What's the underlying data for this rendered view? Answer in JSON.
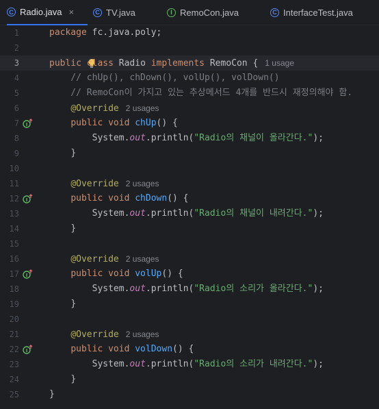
{
  "tabs": [
    {
      "label": "Radio.java",
      "icon": "class-icon",
      "active": true,
      "close": "×"
    },
    {
      "label": "TV.java",
      "icon": "class-icon",
      "active": false
    },
    {
      "label": "RemoCon.java",
      "icon": "interface-icon",
      "active": false
    },
    {
      "label": "InterfaceTest.java",
      "icon": "class-icon",
      "active": false
    }
  ],
  "current_line": 3,
  "line_numbers": [
    "1",
    "2",
    "3",
    "4",
    "5",
    "6",
    "7",
    "8",
    "9",
    "10",
    "11",
    "12",
    "13",
    "14",
    "15",
    "16",
    "17",
    "18",
    "19",
    "20",
    "21",
    "22",
    "23",
    "24",
    "25"
  ],
  "code": {
    "l1_package": "package",
    "l1_name": " fc.java.poly;",
    "l3_public": "public",
    "l3_class": "class",
    "l3_name": " Radio ",
    "l3_implements": "implements",
    "l3_rest": " RemoCon {",
    "l3_hint": "1 usage",
    "l4_comment": "    // chUp(), chDown(), volUp(), volDown()",
    "l5_comment": "    // RemoCon이 가지고 있는 추상메서드 4개를 반드시 재정의해야 함.",
    "override": "@Override",
    "usages": "2 usages",
    "public_void": "public void",
    "system": "System.",
    "out": "out",
    "println": ".println(",
    "close_stmt": ");",
    "close_brace": "}",
    "methods": [
      {
        "name": "chUp",
        "text": "\"Radio의 채널이 올라간다.\""
      },
      {
        "name": "chDown",
        "text": "\"Radio의 채널이 내려간다.\""
      },
      {
        "name": "volUp",
        "text": "\"Radio의 소리가 올라간다.\""
      },
      {
        "name": "volDown",
        "text": "\"Radio의 소리가 내려간다.\""
      }
    ]
  }
}
